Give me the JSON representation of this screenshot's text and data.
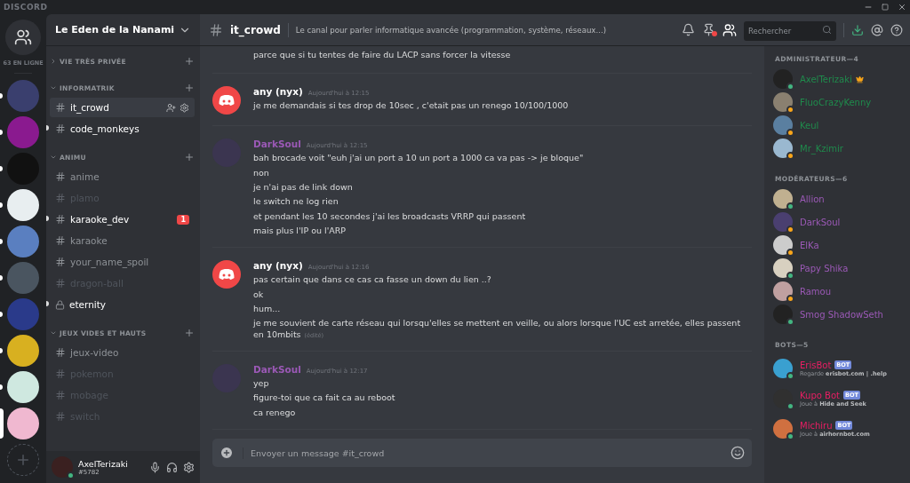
{
  "app_title": "DISCORD",
  "home": {
    "online_count": "63 EN LIGNE"
  },
  "servers": [
    {
      "color": "#3a3f6e",
      "unread": true,
      "selected": false
    },
    {
      "color": "#8a1a8f",
      "unread": true,
      "selected": false
    },
    {
      "color": "#111111",
      "unread": true,
      "selected": false
    },
    {
      "color": "#e8eef0",
      "unread": true,
      "selected": false
    },
    {
      "color": "#5a7fc0",
      "unread": true,
      "selected": false
    },
    {
      "color": "#4a5560",
      "unread": true,
      "selected": false
    },
    {
      "color": "#2a3a8a",
      "unread": true,
      "selected": false
    },
    {
      "color": "#d8b020",
      "unread": true,
      "selected": false
    },
    {
      "color": "#cfe8e0",
      "unread": true,
      "selected": false
    },
    {
      "color": "#f0b8d0",
      "unread": false,
      "selected": true
    }
  ],
  "server_name": "Le Eden de la Nanami",
  "categories": [
    {
      "name": "VIE TRÈS PRIVÉE",
      "expanded": false
    },
    {
      "name": "INFORMATRIK",
      "expanded": true,
      "channels": [
        {
          "name": "it_crowd",
          "selected": true,
          "unread": false,
          "muted": false,
          "locked": false
        },
        {
          "name": "code_monkeys",
          "selected": false,
          "unread": true,
          "muted": false,
          "locked": false
        }
      ]
    },
    {
      "name": "ANIMU",
      "expanded": true,
      "channels": [
        {
          "name": "anime",
          "selected": false,
          "unread": false,
          "muted": false,
          "locked": false
        },
        {
          "name": "plamo",
          "selected": false,
          "unread": false,
          "muted": true,
          "locked": false
        },
        {
          "name": "karaoke_dev",
          "selected": false,
          "unread": true,
          "muted": false,
          "locked": false,
          "badge": "1"
        },
        {
          "name": "karaoke",
          "selected": false,
          "unread": false,
          "muted": false,
          "locked": false
        },
        {
          "name": "your_name_spoil",
          "selected": false,
          "unread": false,
          "muted": false,
          "locked": false
        },
        {
          "name": "dragon-ball",
          "selected": false,
          "unread": false,
          "muted": true,
          "locked": false
        },
        {
          "name": "eternity",
          "selected": false,
          "unread": true,
          "muted": false,
          "locked": true
        }
      ]
    },
    {
      "name": "JEUX VIDES ET HAUTS",
      "expanded": true,
      "channels": [
        {
          "name": "jeux-video",
          "selected": false,
          "unread": false,
          "muted": false,
          "locked": false
        },
        {
          "name": "pokemon",
          "selected": false,
          "unread": false,
          "muted": true,
          "locked": false
        },
        {
          "name": "mobage",
          "selected": false,
          "unread": false,
          "muted": true,
          "locked": false
        },
        {
          "name": "switch",
          "selected": false,
          "unread": false,
          "muted": true,
          "locked": false
        }
      ]
    }
  ],
  "user_panel": {
    "name": "AxelTerizaki",
    "tag": "#5782",
    "color": "#43b581"
  },
  "header": {
    "channel": "it_crowd",
    "topic": "Le canal pour parler informatique avancée (programmation, système, réseaux...)",
    "search_placeholder": "Rechercher",
    "pins_unread": true
  },
  "messages": [
    {
      "kind": "continuation",
      "lines": [
        "parce que si tu tentes de faire du LACP sans forcer la vitesse"
      ]
    },
    {
      "kind": "default",
      "author": "any (nyx)",
      "color": "#ffffff",
      "time": "Aujourd'hui à 12:15",
      "lines": [
        "je me demandais si tes drop de 10sec , c'etait pas un renego 10/100/1000"
      ]
    },
    {
      "kind": "photo",
      "author": "DarkSoul",
      "color": "#9b59b6",
      "time": "Aujourd'hui à 12:15",
      "lines": [
        "bah brocade voit \"euh j'ai un port a 10 un port a 1000 ca va pas -> je bloque\"",
        "non",
        "je n'ai pas de link down",
        "le switch ne log rien",
        "et pendant les 10 secondes j'ai les broadcasts VRRP qui passent",
        "mais plus l'IP ou l'ARP"
      ]
    },
    {
      "kind": "default",
      "author": "any (nyx)",
      "color": "#ffffff",
      "time": "Aujourd'hui à 12:16",
      "lines": [
        "pas certain que dans ce cas ca fasse un down du lien ..?",
        "ok",
        "hum...",
        "je me souvient de carte réseau qui lorsqu'elles se mettent en veille, ou alors lorsque l'UC est arretée, elles passent en 10mbits"
      ],
      "edited_note": "(édité)"
    },
    {
      "kind": "photo",
      "author": "DarkSoul",
      "color": "#9b59b6",
      "time": "Aujourd'hui à 12:17",
      "lines": [
        "yep",
        "figure-toi que ca fait ca au reboot",
        "ca renego"
      ]
    }
  ],
  "composer": {
    "placeholder": "Envoyer un message #it_crowd"
  },
  "member_groups": [
    {
      "title": "ADMINISTRATEUR—4",
      "color": "#1f8b4c",
      "members": [
        {
          "name": "AxelTerizaki",
          "color": "#43b581",
          "owner": true
        },
        {
          "name": "FluoCrazyKenny",
          "color": "#faa61a",
          "owner": false
        },
        {
          "name": "Keul",
          "color": "#faa61a",
          "owner": false
        },
        {
          "name": "Mr_Kzimir",
          "color": "#faa61a",
          "owner": false
        }
      ]
    },
    {
      "title": "MODÉRATEURS—6",
      "color": "#9b59b6",
      "members": [
        {
          "name": "Allion",
          "color": "#43b581",
          "owner": false
        },
        {
          "name": "DarkSoul",
          "color": "#faa61a",
          "owner": false
        },
        {
          "name": "ElKa",
          "color": "#faa61a",
          "owner": false
        },
        {
          "name": "Papy Shika",
          "color": "#43b581",
          "owner": false
        },
        {
          "name": "Ramou",
          "color": "#faa61a",
          "owner": false
        },
        {
          "name": "Smog ShadowSeth",
          "color": "#43b581",
          "owner": false
        }
      ]
    },
    {
      "title": "BOTS—5",
      "color": "#e91e63",
      "members": [
        {
          "name": "ErisBot",
          "color": "#43b581",
          "owner": false,
          "tag": "BOT",
          "activity": "Regarde **erisbot.com | .help**"
        },
        {
          "name": "Kupo Bot",
          "color": "#43b581",
          "owner": false,
          "tag": "BOT",
          "activity": "Joue à **Hide and Seek**"
        },
        {
          "name": "Michiru",
          "color": "#43b581",
          "owner": false,
          "tag": "BOT",
          "activity": "Joue à **airhornbot.com**"
        }
      ]
    }
  ]
}
